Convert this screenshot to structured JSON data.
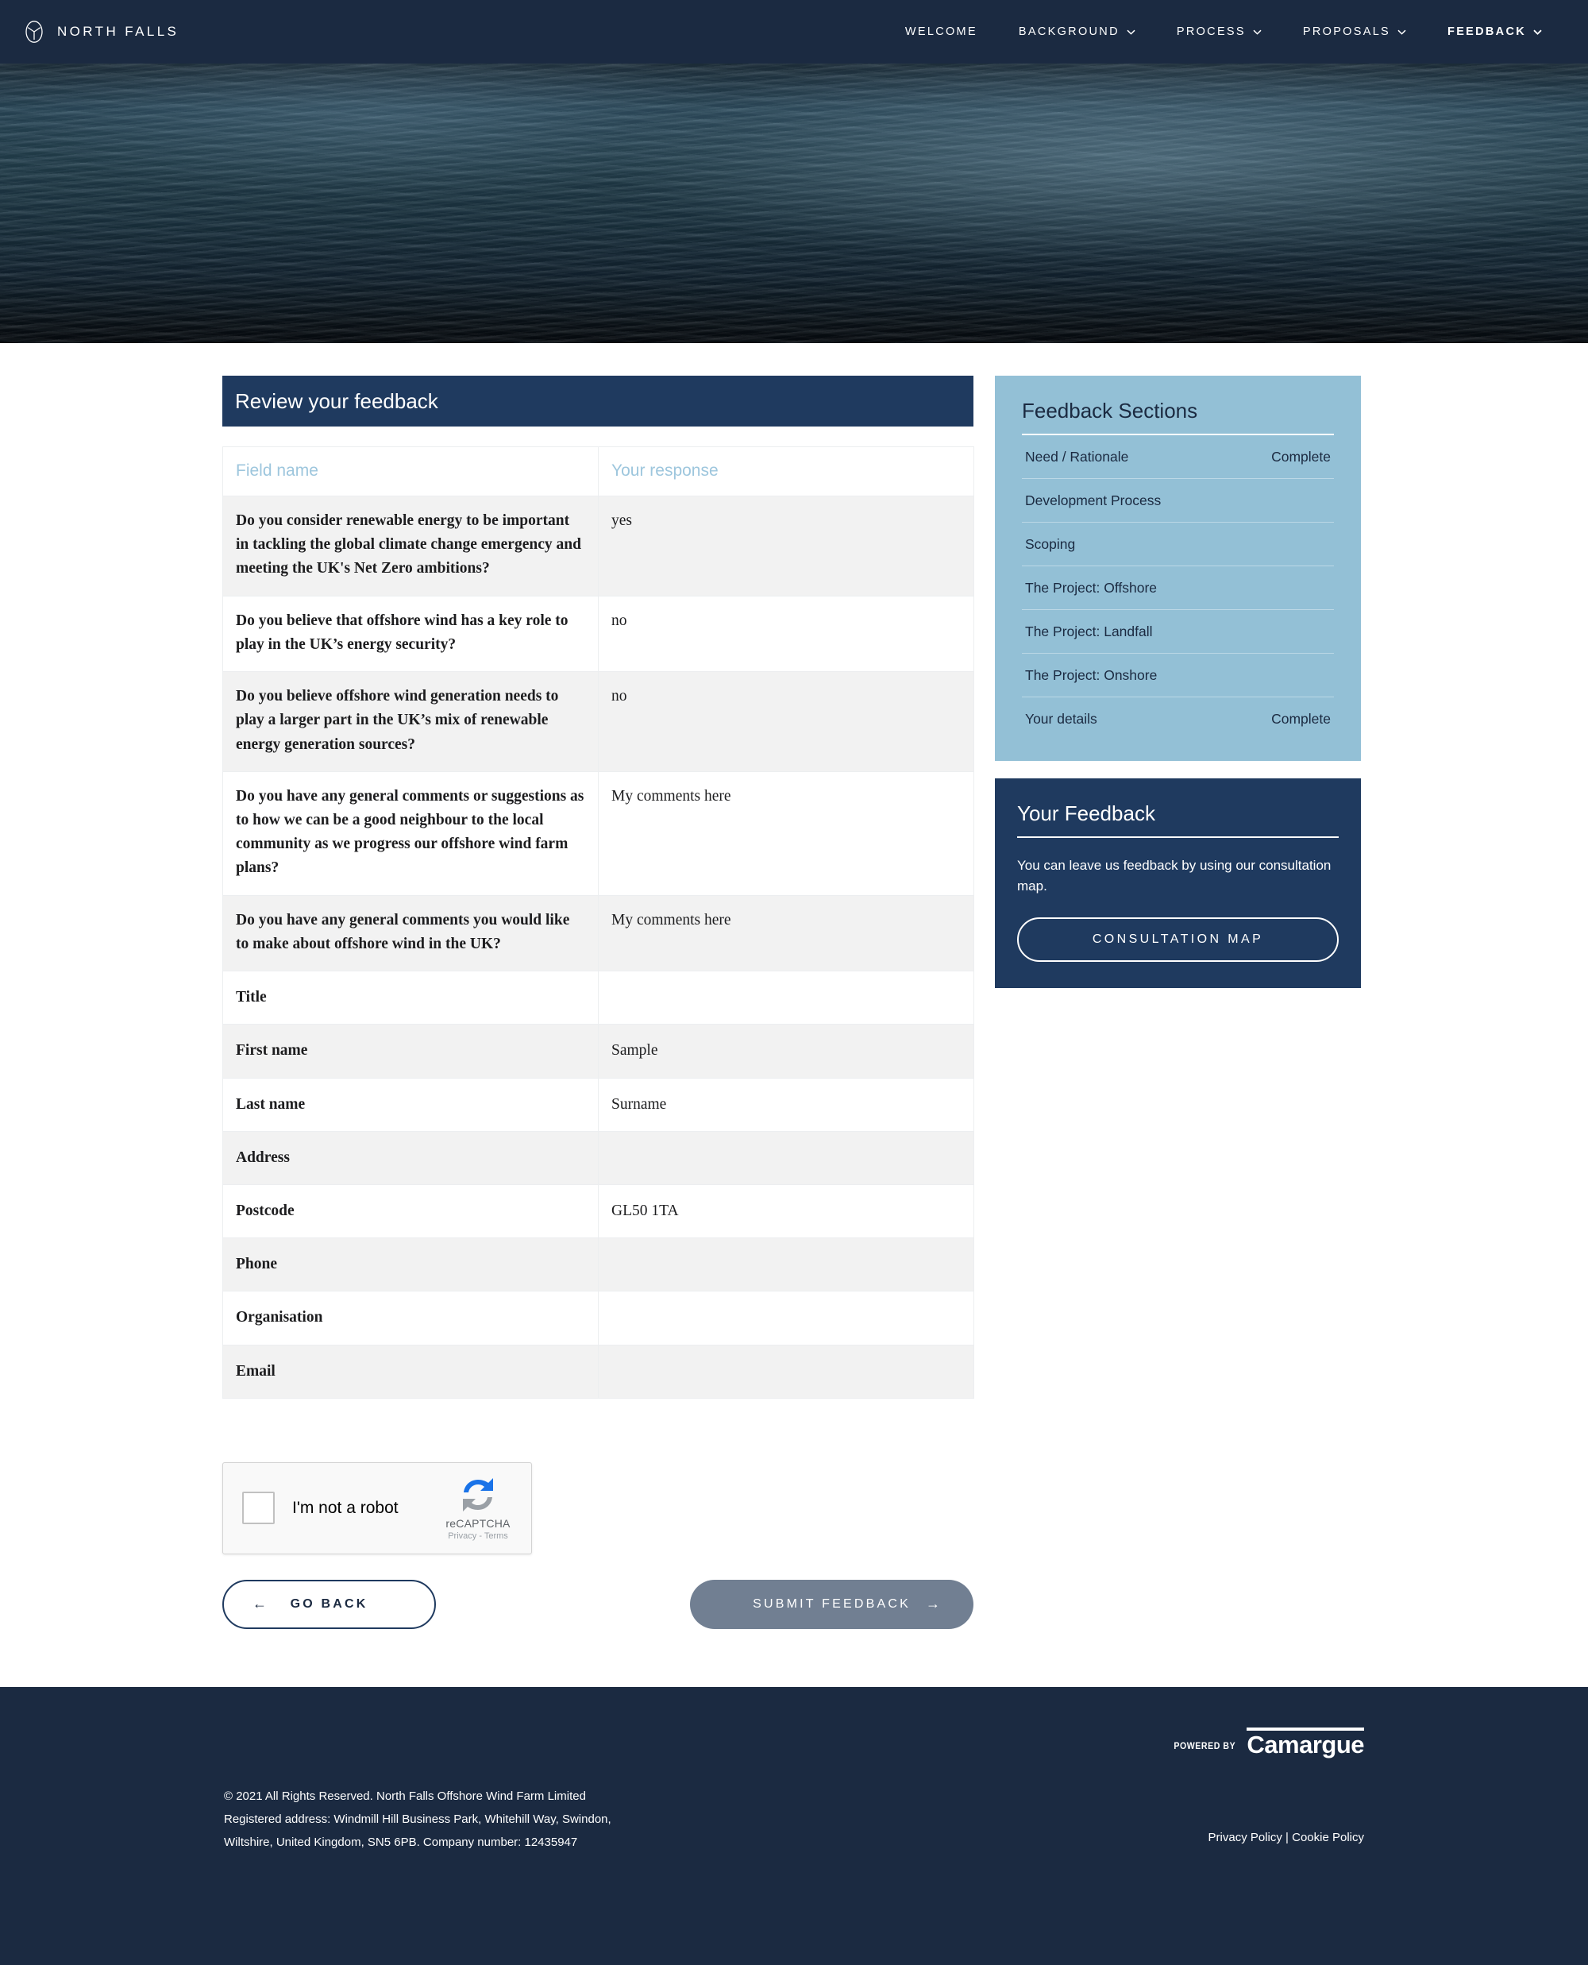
{
  "header": {
    "brand": "NORTH FALLS",
    "brand_icon": "wind-turbine-circle-logo",
    "nav": [
      {
        "label": "WELCOME",
        "has_caret": false,
        "active": false
      },
      {
        "label": "BACKGROUND",
        "has_caret": true,
        "active": false
      },
      {
        "label": "PROCESS",
        "has_caret": true,
        "active": false
      },
      {
        "label": "PROPOSALS",
        "has_caret": true,
        "active": false
      },
      {
        "label": "FEEDBACK",
        "has_caret": true,
        "active": true
      }
    ]
  },
  "hero": {
    "alt": "dark-sea-surface-photo"
  },
  "main": {
    "panel_title": "Review your feedback",
    "table": {
      "columns": [
        "Field name",
        "Your response"
      ],
      "rows": [
        {
          "field": "Do you consider renewable energy to be important in tackling the global climate change emergency and meeting the UK's Net Zero ambitions?",
          "response": "yes"
        },
        {
          "field": "Do you believe that offshore wind has a key role to play in the UK’s energy security?",
          "response": "no"
        },
        {
          "field": "Do you believe offshore wind generation needs to play a larger part in the UK’s mix of renewable energy generation sources?",
          "response": "no"
        },
        {
          "field": "Do you have any general comments or suggestions as to how we can be a good neighbour to the local community as we progress our offshore wind farm plans?",
          "response": "My comments here"
        },
        {
          "field": "Do you have any general comments you would like to make about offshore wind in the UK?",
          "response": "My comments here"
        },
        {
          "field": "Title",
          "response": ""
        },
        {
          "field": "First name",
          "response": "Sample"
        },
        {
          "field": "Last name",
          "response": "Surname"
        },
        {
          "field": "Address",
          "response": ""
        },
        {
          "field": "Postcode",
          "response": "GL50 1TA"
        },
        {
          "field": "Phone",
          "response": ""
        },
        {
          "field": "Organisation",
          "response": ""
        },
        {
          "field": "Email",
          "response": ""
        }
      ]
    }
  },
  "captcha": {
    "label": "I'm not a robot",
    "brand": "reCAPTCHA",
    "links": "Privacy - Terms",
    "logo_icon": "recaptcha-arrows-icon"
  },
  "actions": {
    "back_label": "GO BACK",
    "back_arrow": "←",
    "submit_label": "SUBMIT FEEDBACK",
    "submit_arrow": "→"
  },
  "sidebar": {
    "sections_card": {
      "title": "Feedback Sections",
      "items": [
        {
          "label": "Need / Rationale",
          "status": "Complete"
        },
        {
          "label": "Development Process",
          "status": ""
        },
        {
          "label": "Scoping",
          "status": ""
        },
        {
          "label": "The Project: Offshore",
          "status": ""
        },
        {
          "label": "The Project: Landfall",
          "status": ""
        },
        {
          "label": "The Project: Onshore",
          "status": ""
        },
        {
          "label": "Your details",
          "status": "Complete"
        }
      ]
    },
    "feedback_card": {
      "title": "Your Feedback",
      "text": "You can leave us feedback by using our consultation map.",
      "button_label": "CONSULTATION MAP"
    }
  },
  "footer": {
    "powered_label": "POWERED BY",
    "powered_brand": "Camargue",
    "legal_line1": "© 2021 All Rights Reserved. North Falls Offshore Wind Farm Limited",
    "legal_line2": "Registered address: Windmill Hill Business Park, Whitehill Way, Swindon,",
    "legal_line3": "Wiltshire, United Kingdom, SN5 6PB. Company number: 12435947",
    "privacy": "Privacy Policy",
    "separator": " | ",
    "cookie": "Cookie Policy"
  },
  "colors": {
    "navy": "#1b2a41",
    "panel_navy": "#1f3a5f",
    "light_blue": "#93c0d6",
    "header_text_blue": "#9dc6dd",
    "submit_grey": "#717f92",
    "row_alt": "#f2f2f2"
  }
}
